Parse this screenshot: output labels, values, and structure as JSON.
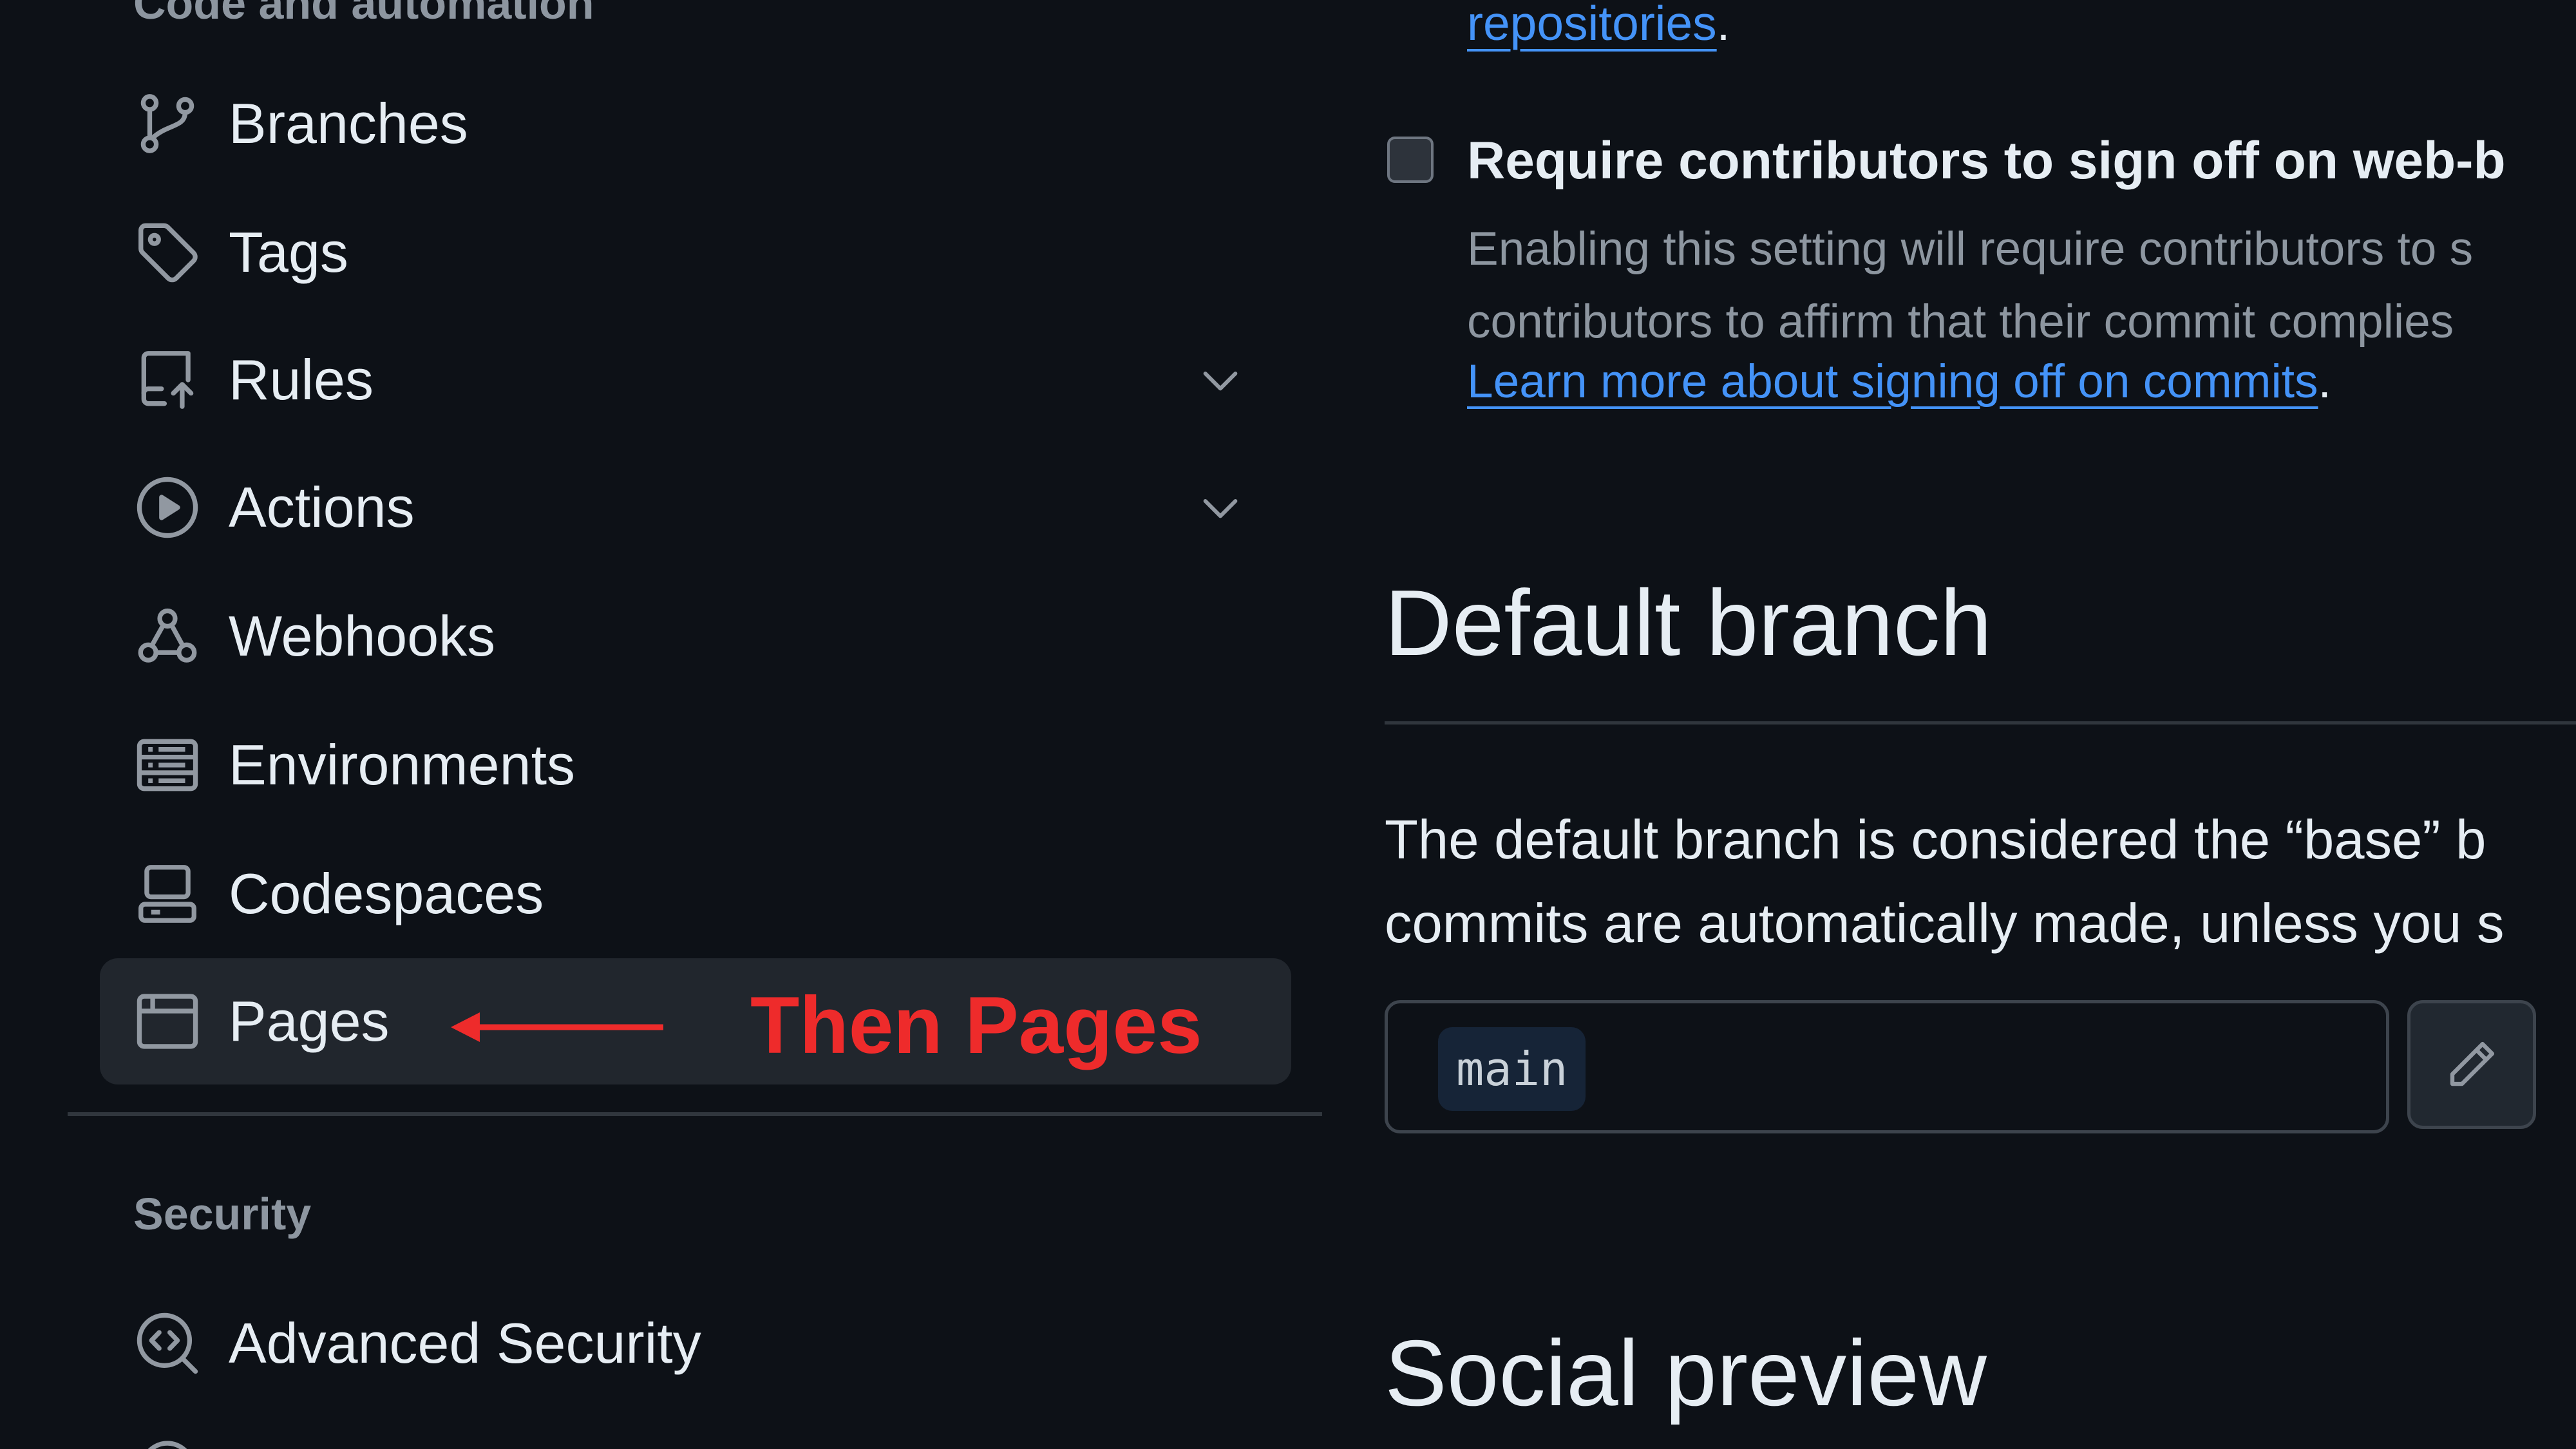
{
  "sidebar": {
    "section_code": "Code and automation",
    "section_security": "Security",
    "items": [
      {
        "label": "Branches",
        "icon": "git-branch-icon"
      },
      {
        "label": "Tags",
        "icon": "tag-icon"
      },
      {
        "label": "Rules",
        "icon": "repo-push-icon",
        "expandable": true
      },
      {
        "label": "Actions",
        "icon": "play-icon",
        "expandable": true
      },
      {
        "label": "Webhooks",
        "icon": "webhook-icon"
      },
      {
        "label": "Environments",
        "icon": "server-icon"
      },
      {
        "label": "Codespaces",
        "icon": "codespaces-icon"
      },
      {
        "label": "Pages",
        "icon": "browser-icon",
        "active": true
      }
    ],
    "security_items": [
      {
        "label": "Advanced Security",
        "icon": "codescan-icon"
      }
    ]
  },
  "annotation": {
    "text": "Then Pages",
    "color": "#ee2b2b"
  },
  "main": {
    "top_link": "repositories",
    "top_link_suffix": ".",
    "signoff": {
      "title": "Require contributors to sign off on web-b",
      "desc_line1": "Enabling this setting will require contributors to s",
      "desc_line2": "contributors to affirm that their commit complies",
      "learn_more": "Learn more about signing off on commits",
      "learn_more_suffix": ".",
      "checked": false
    },
    "default_branch": {
      "heading": "Default branch",
      "desc_line1": "The default branch is considered the “base” b",
      "desc_line2": "commits are automatically made, unless you s",
      "branch_name": "main"
    },
    "social_preview": {
      "heading": "Social preview"
    }
  },
  "colors": {
    "background": "#0d1117",
    "link": "#4493f8",
    "muted": "#8d96a0",
    "active_bg": "#21262d"
  }
}
